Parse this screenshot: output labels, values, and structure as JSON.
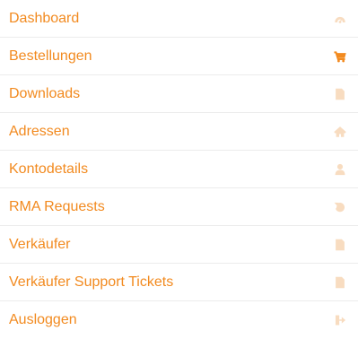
{
  "nav": {
    "items": [
      {
        "label": "Dashboard",
        "icon": "dashboard-icon",
        "active": false
      },
      {
        "label": "Bestellungen",
        "icon": "shopping-cart-icon",
        "active": true
      },
      {
        "label": "Downloads",
        "icon": "file-icon",
        "active": false
      },
      {
        "label": "Adressen",
        "icon": "home-icon",
        "active": false
      },
      {
        "label": "Kontodetails",
        "icon": "user-icon",
        "active": false
      },
      {
        "label": "RMA Requests",
        "icon": "undo-icon",
        "active": false
      },
      {
        "label": "Verkäufer",
        "icon": "file-icon",
        "active": false
      },
      {
        "label": "Verkäufer Support Tickets",
        "icon": "file-icon",
        "active": false
      },
      {
        "label": "Ausloggen",
        "icon": "sign-out-icon",
        "active": false
      }
    ]
  },
  "colors": {
    "link": "#f28a1f",
    "icon_active": "#f28a1f",
    "icon_muted": "#f8dcc0",
    "divider": "#ececec"
  }
}
